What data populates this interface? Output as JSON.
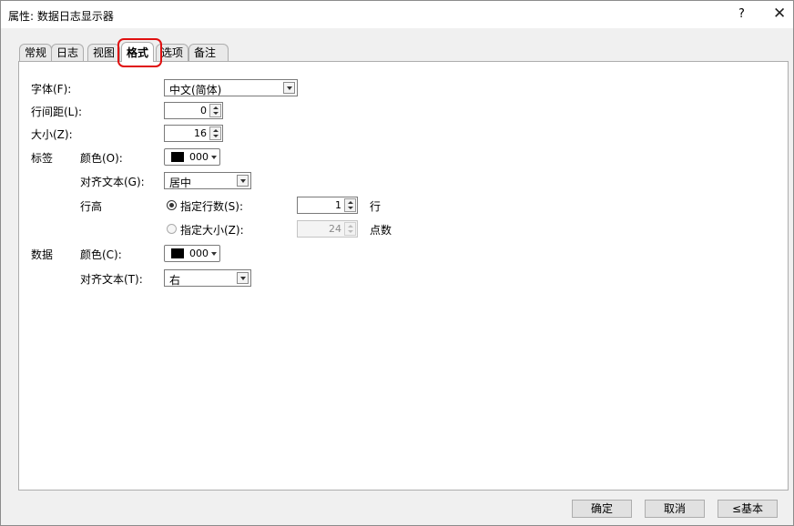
{
  "window": {
    "title": "属性: 数据日志显示器",
    "help": "?",
    "close": "✕"
  },
  "tabs": [
    {
      "label": "常规"
    },
    {
      "label": "日志"
    },
    {
      "label": "视图"
    },
    {
      "label": "格式",
      "active": true
    },
    {
      "label": "选项"
    },
    {
      "label": "备注"
    }
  ],
  "format": {
    "font_label": "字体(F):",
    "font_value": "中文(简体)",
    "line_spacing_label": "行间距(L):",
    "line_spacing_value": "0",
    "size_label": "大小(Z):",
    "size_value": "16",
    "label_section": "标签",
    "label_color_label": "颜色(O):",
    "label_color_value": "000",
    "label_color_hex": "#000000",
    "label_align_label": "对齐文本(G):",
    "label_align_value": "居中",
    "row_height_label": "行高",
    "specify_rows_label": "指定行数(S):",
    "specify_rows_value": "1",
    "rows_unit": "行",
    "specify_rows_selected": true,
    "specify_size_label": "指定大小(Z):",
    "specify_size_value": "24",
    "size_unit": "点数",
    "data_section": "数据",
    "data_color_label": "颜色(C):",
    "data_color_value": "000",
    "data_color_hex": "#000000",
    "data_align_label": "对齐文本(T):",
    "data_align_value": "右"
  },
  "buttons": {
    "ok": "确定",
    "cancel": "取消",
    "basic": "≤基本"
  },
  "colors": {
    "highlight": "#e01010"
  }
}
